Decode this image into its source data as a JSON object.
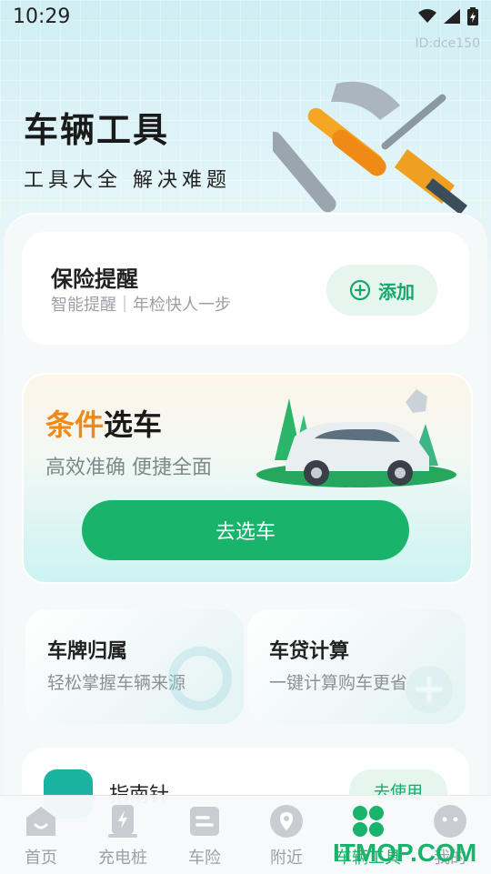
{
  "status_bar": {
    "time": "10:29"
  },
  "id_label": "ID:dce150",
  "hero": {
    "title": "车辆工具",
    "subtitle": "工具大全 解决难题"
  },
  "insurance": {
    "title": "保险提醒",
    "subtitle": "智能提醒｜年检快人一步",
    "add_label": "添加"
  },
  "select_car": {
    "title_highlight": "条件",
    "title_rest": "选车",
    "subtitle": "高效准确 便捷全面",
    "button_label": "去选车"
  },
  "plate": {
    "title": "车牌归属",
    "subtitle": "轻松掌握车辆来源"
  },
  "loan": {
    "title": "车贷计算",
    "subtitle": "一键计算购车更省"
  },
  "guide": {
    "title": "指南针",
    "button_label": "去使用"
  },
  "tabs": [
    {
      "label": "首页",
      "icon": "home-icon"
    },
    {
      "label": "充电桩",
      "icon": "charger-icon"
    },
    {
      "label": "车险",
      "icon": "insurance-icon"
    },
    {
      "label": "附近",
      "icon": "location-icon"
    },
    {
      "label": "车辆工具",
      "icon": "tools-grid-icon"
    },
    {
      "label": "我的",
      "icon": "profile-icon"
    }
  ],
  "watermark": "ITMOP.COM",
  "colors": {
    "accent": "#19b36b",
    "highlight": "#f08a16"
  }
}
